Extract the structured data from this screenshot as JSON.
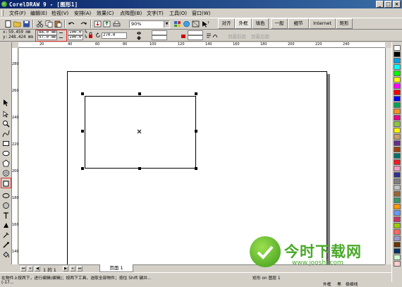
{
  "window": {
    "title": "CorelDRAW 9 - [图形1]",
    "minimize_glyph": "_",
    "maximize_glyph": "□",
    "close_glyph": "×"
  },
  "menu": [
    "文件(F)",
    "编辑(E)",
    "检视(V)",
    "安排(A)",
    "效果(C)",
    "点阵图(B)",
    "文字(T)",
    "工具(O)",
    "窗口(W)"
  ],
  "standard_toolbar": {
    "zoom_value": "90%",
    "zoom_arrow": "▼"
  },
  "docker_tabs": [
    "对齐",
    "外框",
    "填色",
    "一般",
    "细节",
    "Internet",
    "矩形"
  ],
  "property_bar": {
    "x_label": "x:",
    "x_value": "59.459 mm",
    "y_label": "y:",
    "y_value": "248.424 mm",
    "width_value": "88.0 mm",
    "height_value": "57.0 mm",
    "scale_w": "100.0",
    "scale_h": "100.0",
    "percent": "%",
    "rotation": "270.0",
    "to_front": "到最前面",
    "to_back": "到最后面"
  },
  "rulers": {
    "top_ticks": [
      "20",
      "40",
      "60",
      "80",
      "100",
      "120",
      "140",
      "160",
      "180",
      "200",
      "220",
      "240"
    ],
    "left_ticks": [
      "280",
      "260",
      "240",
      "220",
      "200",
      "180",
      "160",
      "140"
    ]
  },
  "page_tabs": {
    "page_counter": "1 的 1",
    "page_tab": "页面 1"
  },
  "status_bar": {
    "line1": "在物件上按两下，进行编辑(编辑)；按两下工具，选取全部物件；按住 Shift 键并...",
    "line2": "(-17...",
    "object_info": "矩形 on 图层 1",
    "fill_label": "外框",
    "fill_value": "黑",
    "outline_value": "极细线"
  },
  "watermark": {
    "title": "今时下载网",
    "url": "www.jooshi.com"
  },
  "colors": {
    "title_bar": "#0a246a",
    "highlight_box": "#e03030",
    "watermark_green": "#4aa82a",
    "palette": [
      "#ffffff",
      "#000000",
      "#00a0e9",
      "#00ffff",
      "#00ff00",
      "#ffff00",
      "#ff00ff",
      "#ff0000",
      "#0000ff",
      "#00a651",
      "#f7941d",
      "#ec008c",
      "#8dc63f",
      "#fff200",
      "#c69c6d",
      "#662d91",
      "#a0410d",
      "#00746b",
      "#ed1c24",
      "#f49ac1",
      "#2e3192",
      "#808080",
      "#c0c0c0",
      "#996633",
      "#339966",
      "#ff9900",
      "#6699ff",
      "#cc3366",
      "#99cc00",
      "#ff6666",
      "#9999cc",
      "#663300",
      "#003366",
      "#ccffcc",
      "#ffcccc"
    ]
  }
}
